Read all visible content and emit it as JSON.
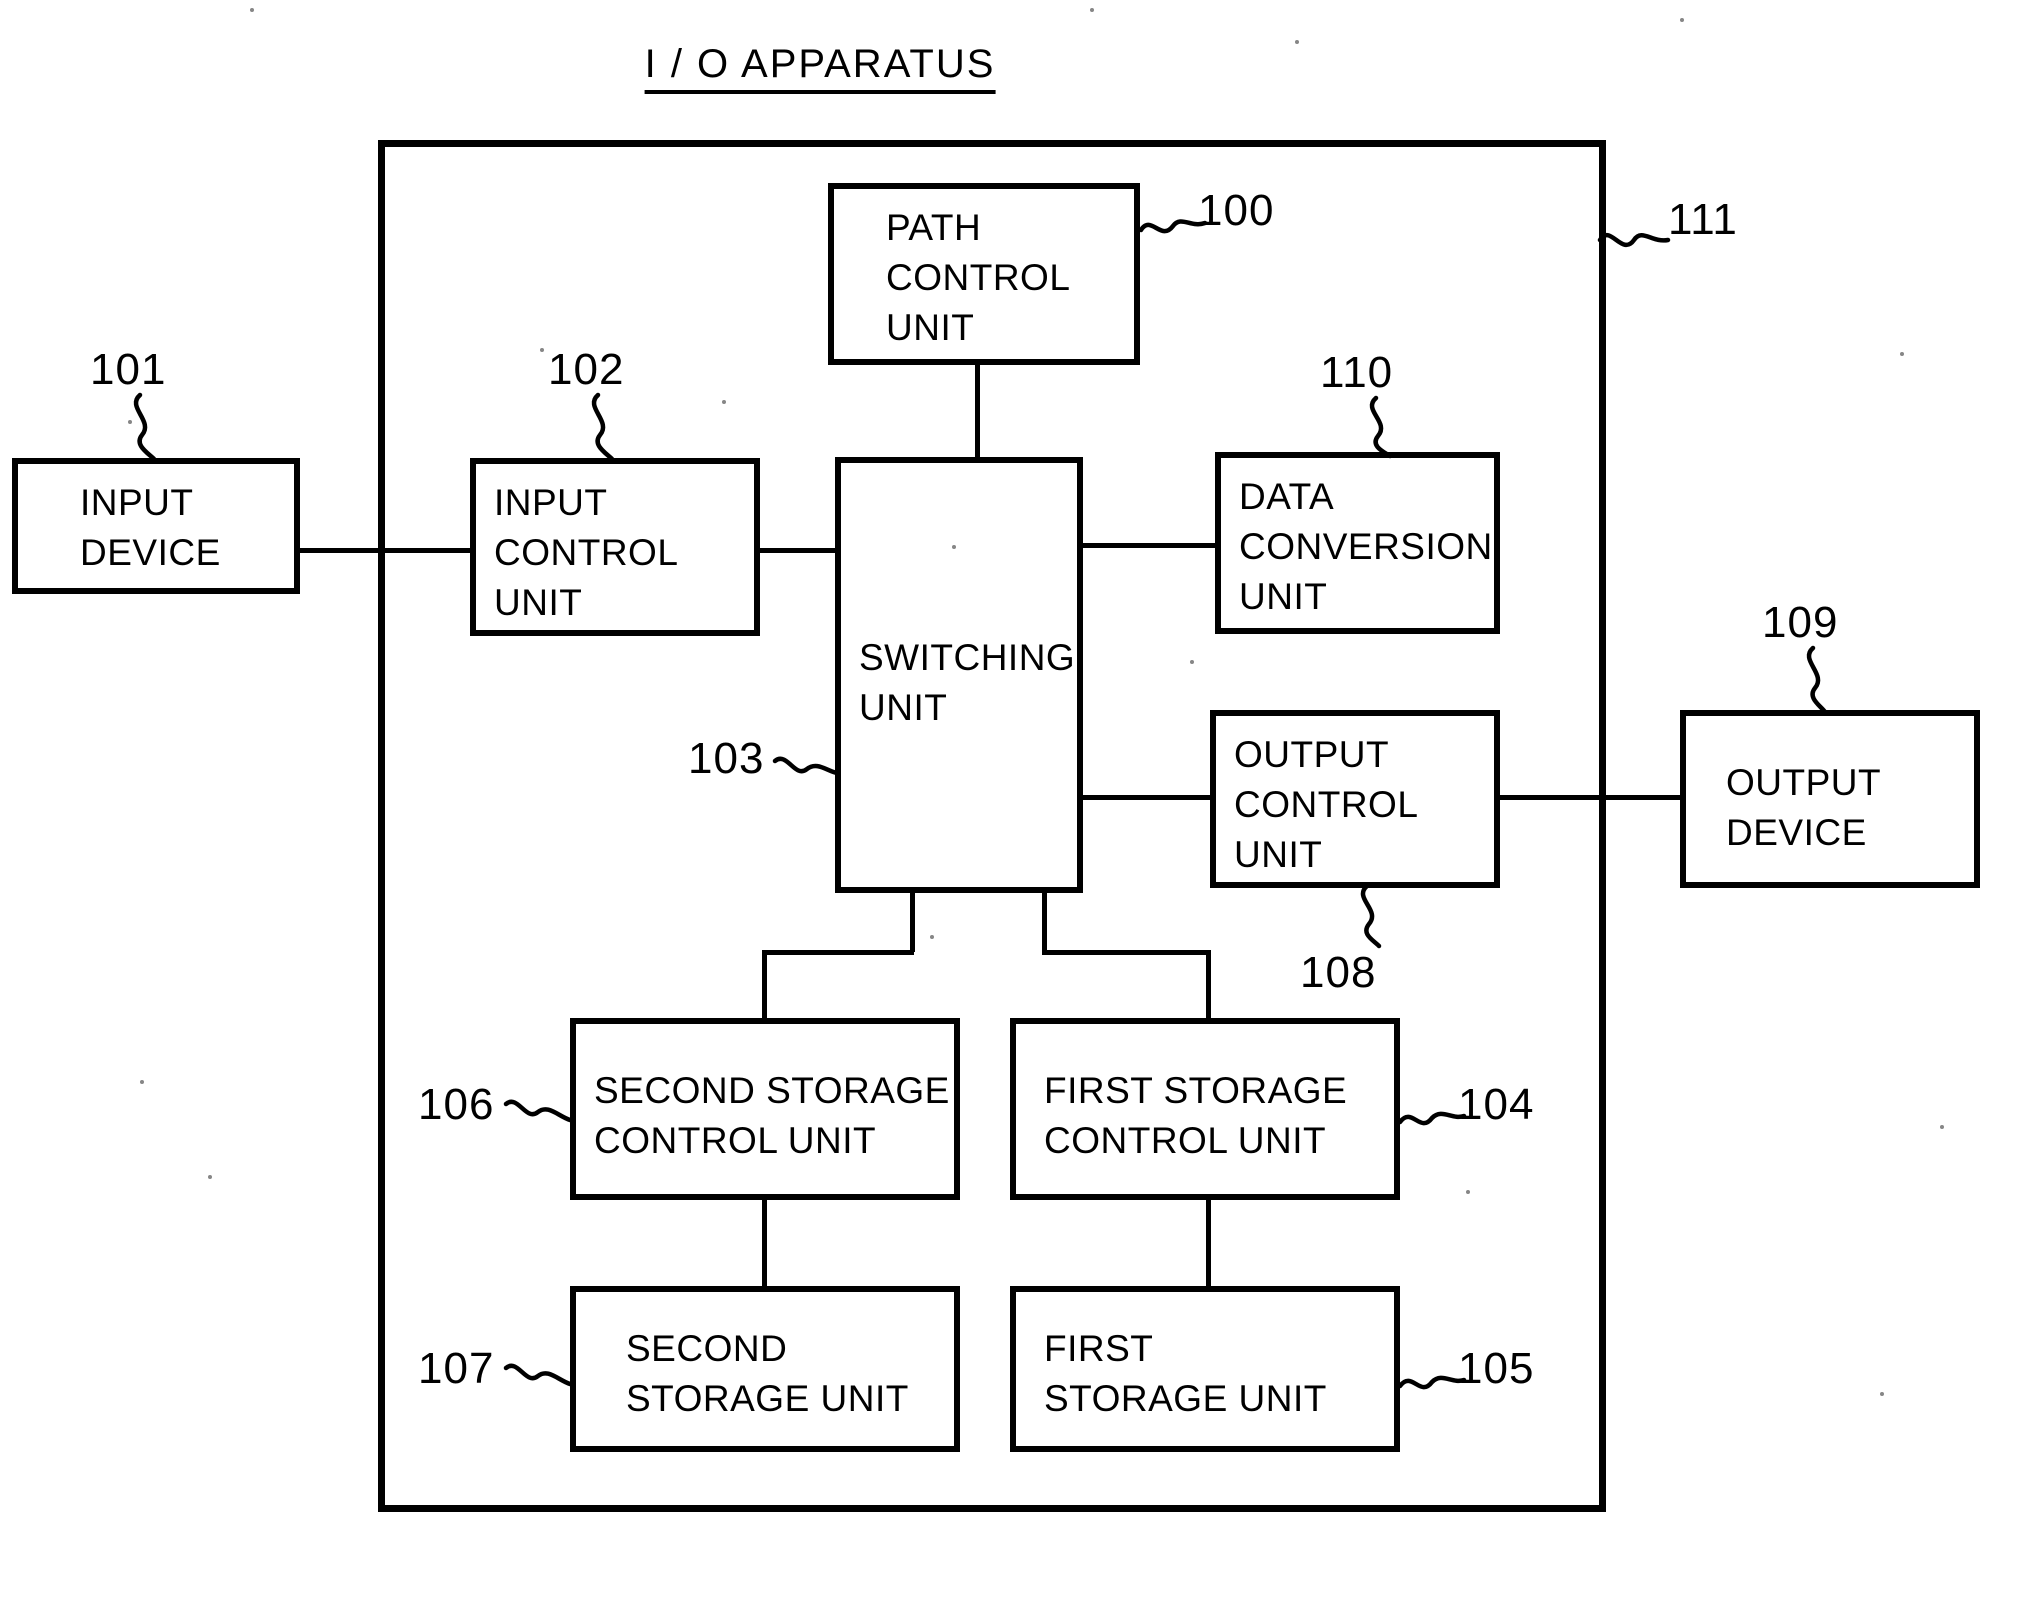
{
  "figure": {
    "title": "I / O APPARATUS"
  },
  "blocks": {
    "input_device": {
      "label": "INPUT\nDEVICE",
      "ref": "101"
    },
    "input_control_unit": {
      "label": "INPUT\nCONTROL\nUNIT",
      "ref": "102"
    },
    "path_control_unit": {
      "label": "PATH\nCONTROL\nUNIT",
      "ref": "100"
    },
    "switching_unit": {
      "label": "SWITCHING\nUNIT",
      "ref": "103"
    },
    "data_conversion_unit": {
      "label": "DATA\nCONVERSION\nUNIT",
      "ref": "110"
    },
    "output_control_unit": {
      "label": "OUTPUT\nCONTROL\nUNIT",
      "ref": "108"
    },
    "output_device": {
      "label": "OUTPUT\nDEVICE",
      "ref": "109"
    },
    "second_storage_control": {
      "label": "SECOND STORAGE\nCONTROL UNIT",
      "ref": "106"
    },
    "first_storage_control": {
      "label": "FIRST STORAGE\nCONTROL UNIT",
      "ref": "104"
    },
    "second_storage_unit": {
      "label": "SECOND\nSTORAGE UNIT",
      "ref": "107"
    },
    "first_storage_unit": {
      "label": "FIRST\nSTORAGE UNIT",
      "ref": "105"
    },
    "enclosure": {
      "label": "",
      "ref": "111"
    }
  },
  "colors": {
    "ink": "#000000",
    "paper": "#ffffff"
  }
}
